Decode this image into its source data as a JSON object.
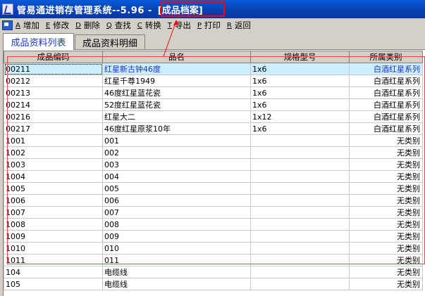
{
  "window": {
    "title": "管易通进销存管理系统--5.96 -",
    "section": "[成品档案]"
  },
  "toolbar": {
    "buttons": [
      {
        "key": "A",
        "label": "增加"
      },
      {
        "key": "E",
        "label": "修改"
      },
      {
        "key": "D",
        "label": "删除"
      },
      {
        "key": "Q",
        "label": "查找"
      },
      {
        "key": "C",
        "label": "转换"
      },
      {
        "key": "T",
        "label": "导出"
      },
      {
        "key": "P",
        "label": "打印"
      },
      {
        "key": "R",
        "label": "返回"
      }
    ]
  },
  "tabs": [
    {
      "label": "成品资料列表",
      "active": true
    },
    {
      "label": "成品资料明细",
      "active": false
    }
  ],
  "table": {
    "columns": [
      "成品编码",
      "品名",
      "规格型号",
      "所属类别"
    ],
    "rows": [
      {
        "code": "00211",
        "name": "红星新古钟46度",
        "spec": "1x6",
        "category": "白酒红星系列",
        "selected": true
      },
      {
        "code": "00212",
        "name": "红星千尊1949",
        "spec": "1x6",
        "category": "白酒红星系列"
      },
      {
        "code": "00213",
        "name": "46度红星蓝花瓷",
        "spec": "1x6",
        "category": "白酒红星系列"
      },
      {
        "code": "00214",
        "name": "52度红星蓝花瓷",
        "spec": "1x6",
        "category": "白酒红星系列"
      },
      {
        "code": "00216",
        "name": "红星大二",
        "spec": "1x12",
        "category": "白酒红星系列"
      },
      {
        "code": "00217",
        "name": "46度红星原浆10年",
        "spec": "1x6",
        "category": "白酒红星系列"
      },
      {
        "code": "1001",
        "name": "001",
        "spec": "",
        "category": "无类别"
      },
      {
        "code": "1002",
        "name": "002",
        "spec": "",
        "category": "无类别"
      },
      {
        "code": "1003",
        "name": "003",
        "spec": "",
        "category": "无类别"
      },
      {
        "code": "1004",
        "name": "004",
        "spec": "",
        "category": "无类别"
      },
      {
        "code": "1005",
        "name": "005",
        "spec": "",
        "category": "无类别"
      },
      {
        "code": "1006",
        "name": "006",
        "spec": "",
        "category": "无类别"
      },
      {
        "code": "1007",
        "name": "007",
        "spec": "",
        "category": "无类别"
      },
      {
        "code": "1008",
        "name": "008",
        "spec": "",
        "category": "无类别"
      },
      {
        "code": "1009",
        "name": "009",
        "spec": "",
        "category": "无类别"
      },
      {
        "code": "1010",
        "name": "010",
        "spec": "",
        "category": "无类别"
      },
      {
        "code": "1011",
        "name": "011",
        "spec": "",
        "category": "无类别"
      },
      {
        "code": "104",
        "name": "电缆线",
        "spec": "",
        "category": "无类别"
      },
      {
        "code": "105",
        "name": "电缆线",
        "spec": "",
        "category": "无类别"
      }
    ]
  },
  "colors": {
    "title_bar": "#0a3fb0",
    "highlight_box": "#ff0000",
    "selected_row": "#ccefff",
    "selected_text": "#1a33c8"
  }
}
